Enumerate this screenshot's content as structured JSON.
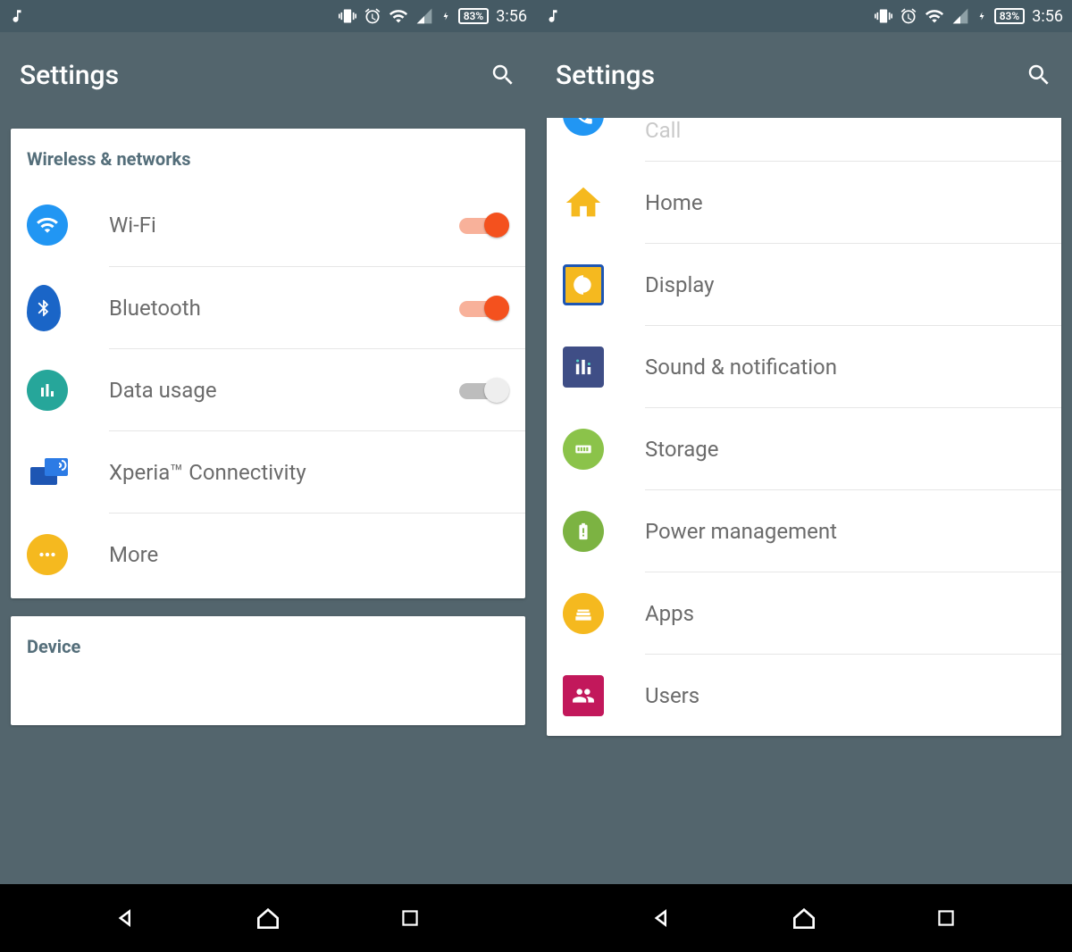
{
  "status": {
    "battery": "83%",
    "clock": "3:56"
  },
  "appbar": {
    "title": "Settings"
  },
  "left": {
    "section1": "Wireless & networks",
    "wifi": "Wi-Fi",
    "bluetooth": "Bluetooth",
    "data": "Data usage",
    "xperia": "Xperia™ Connectivity",
    "more": "More",
    "section2": "Device"
  },
  "right": {
    "call": "Call",
    "home": "Home",
    "display": "Display",
    "sound": "Sound & notification",
    "storage": "Storage",
    "power": "Power management",
    "apps": "Apps",
    "users": "Users"
  }
}
